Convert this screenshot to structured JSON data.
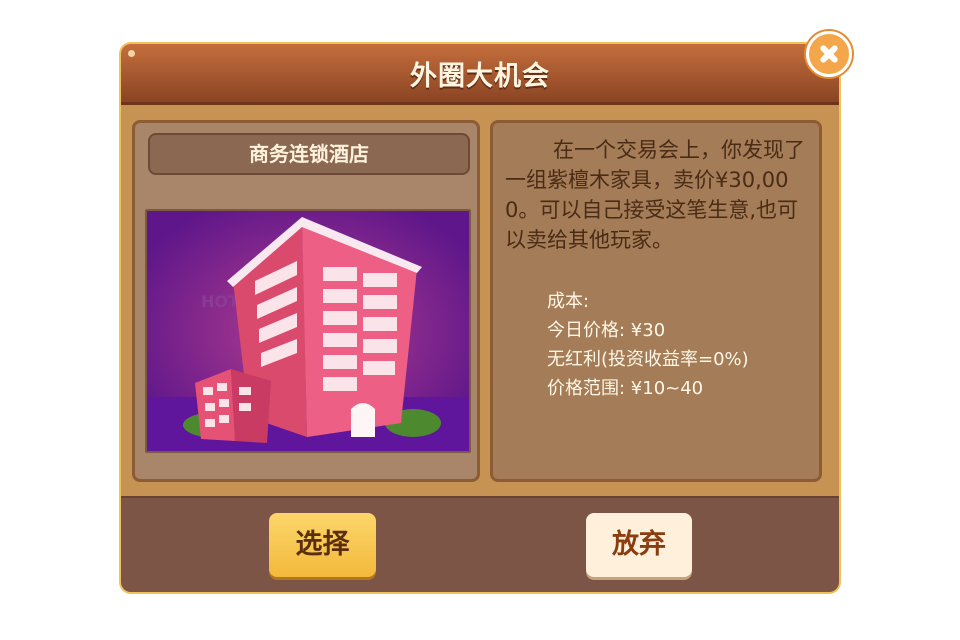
{
  "dialog": {
    "title": "外圈大机会",
    "close_icon": "close-icon"
  },
  "card": {
    "name": "商务连锁酒店",
    "image_sign_text": "HOT"
  },
  "description": "在一个交易会上，你发现了一组紫檀木家具，卖价¥30,000。可以自己接受这笔生意,也可以卖给其他玩家。",
  "stats": {
    "cost": "成本:",
    "today_price": "今日价格: ¥30",
    "dividend": "无红利(投资收益率=0%)",
    "price_range": "价格范围: ¥10~40"
  },
  "buttons": {
    "select": "选择",
    "abandon": "放弃"
  },
  "colors": {
    "title_bar": "#a9552d",
    "panel": "#c79352",
    "footer": "#7d5546",
    "select_button": "#f8c94f",
    "abandon_button": "#fff0dc",
    "image_bg": "#6b1a88"
  }
}
